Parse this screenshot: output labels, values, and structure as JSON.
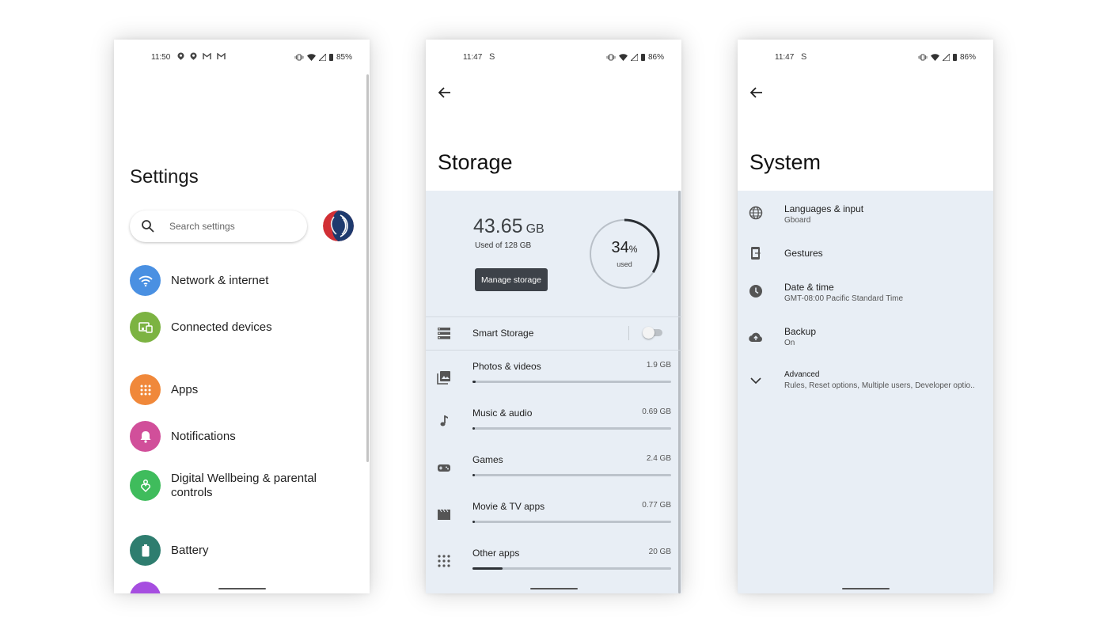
{
  "settings_screen": {
    "status": {
      "time": "11:50",
      "battery": "85%"
    },
    "title": "Settings",
    "search": {
      "placeholder": "Search settings"
    },
    "items": [
      {
        "label": "Network & internet",
        "icon": "wifi-icon",
        "color": "#4a90e2"
      },
      {
        "label": "Connected devices",
        "icon": "devices-icon",
        "color": "#7cb342"
      },
      {
        "label": "Apps",
        "icon": "apps-grid-icon",
        "color": "#f0883a"
      },
      {
        "label": "Notifications",
        "icon": "bell-icon",
        "color": "#d14f9a"
      },
      {
        "label": "Digital Wellbeing & parental",
        "label2": "controls",
        "icon": "wellbeing-icon",
        "color": "#3fbc5c"
      },
      {
        "label": "Battery",
        "icon": "battery-icon",
        "color": "#2e7d6f"
      }
    ]
  },
  "storage_screen": {
    "status": {
      "time": "11:47",
      "battery": "86%"
    },
    "title": "Storage",
    "used_amount": "43.65",
    "used_unit": "GB",
    "used_of": "Used of 128 GB",
    "manage_button": "Manage storage",
    "percent_value": "34",
    "percent_sign": "%",
    "percent_label": "used",
    "percent_fraction": 0.34,
    "smart_storage": {
      "label": "Smart Storage",
      "enabled": false
    },
    "categories": [
      {
        "label": "Photos & videos",
        "size": "1.9 GB",
        "fraction": 0.015
      },
      {
        "label": "Music & audio",
        "size": "0.69 GB",
        "fraction": 0.005
      },
      {
        "label": "Games",
        "size": "2.4 GB",
        "fraction": 0.01
      },
      {
        "label": "Movie & TV apps",
        "size": "0.77 GB",
        "fraction": 0.005
      },
      {
        "label": "Other apps",
        "size": "20 GB",
        "fraction": 0.15
      }
    ]
  },
  "system_screen": {
    "status": {
      "time": "11:47",
      "battery": "86%"
    },
    "title": "System",
    "items": [
      {
        "title": "Languages & input",
        "subtitle": "Gboard",
        "icon": "globe-icon"
      },
      {
        "title": "Gestures",
        "subtitle": "",
        "icon": "gestures-icon"
      },
      {
        "title": "Date & time",
        "subtitle": "GMT-08:00 Pacific Standard Time",
        "icon": "clock-icon"
      },
      {
        "title": "Backup",
        "subtitle": "On",
        "icon": "cloud-upload-icon"
      },
      {
        "title": "Advanced",
        "subtitle": "Rules, Reset options, Multiple users, Developer optio..",
        "icon": "chevron-down-icon"
      }
    ]
  }
}
